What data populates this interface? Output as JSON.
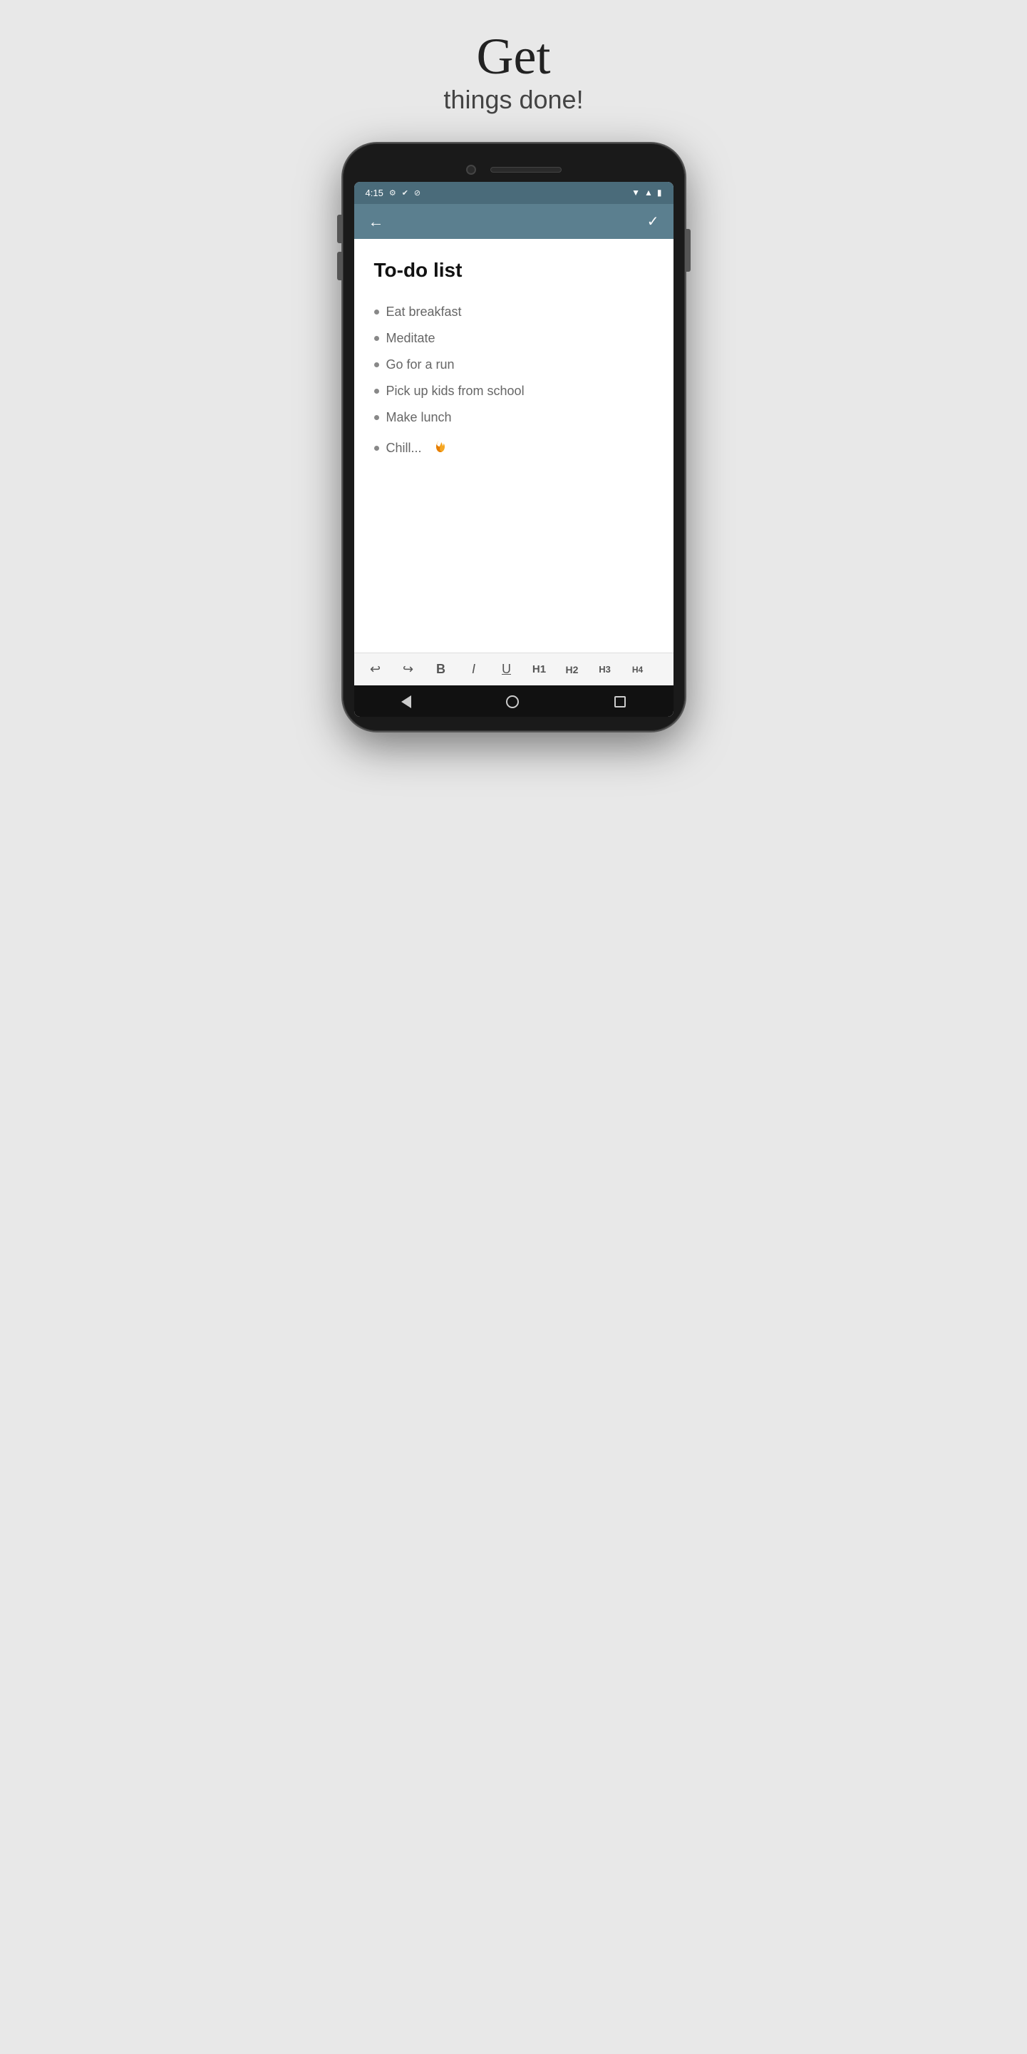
{
  "hero": {
    "line1": "Get",
    "line2": "things done!"
  },
  "statusBar": {
    "time": "4:15",
    "icons": [
      "gear",
      "check-badge",
      "blocked"
    ]
  },
  "toolbar": {
    "backLabel": "←",
    "checkLabel": "✓"
  },
  "note": {
    "title": "To-do list",
    "items": [
      "Eat breakfast",
      "Meditate",
      "Go for a run",
      "Pick up kids from school",
      "Make lunch",
      "Chill..."
    ]
  },
  "formatToolbar": {
    "undo": "↩",
    "redo": "↪",
    "bold": "B",
    "italic": "I",
    "underline": "U",
    "h1": "H1",
    "h2": "H2",
    "h3": "H3",
    "h4": "H4"
  },
  "colors": {
    "statusBarBg": "#4a6b7a",
    "toolbarBg": "#5b7f8f",
    "flameOrange": "#f5a623"
  }
}
